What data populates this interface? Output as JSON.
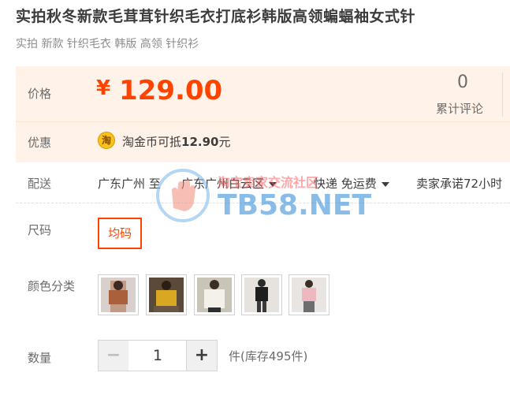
{
  "product": {
    "title": "实拍秋冬新款毛茸茸针织毛衣打底衫韩版高领蝙蝠袖女式针",
    "subtitle": "实拍 新款 针织毛衣 韩版 高领 针织衫"
  },
  "price": {
    "label": "价格",
    "currency": "¥",
    "value": "129.00",
    "review_count": "0",
    "review_label": "累计评论"
  },
  "promo": {
    "label": "优惠",
    "coin_icon_text": "淘",
    "text_prefix": "淘金币可抵",
    "amount": "12.90",
    "text_suffix": "元"
  },
  "delivery": {
    "label": "配送",
    "from": "广东广州 至",
    "to": "广东广州白云区",
    "method": "快递 免运费",
    "promise": "卖家承诺72小时"
  },
  "size": {
    "label": "尺码",
    "options": [
      "均码"
    ]
  },
  "color": {
    "label": "颜色分类",
    "thumbnails": [
      "brown-sweater-thumb",
      "yellow-sweater-thumb",
      "white-sweater-thumb",
      "black-outfit-thumb",
      "pink-sweater-thumb"
    ]
  },
  "quantity": {
    "label": "数量",
    "minus": "−",
    "value": "1",
    "plus": "+",
    "stock_text": "件(库存495件)"
  },
  "watermark": {
    "top_text": "淘宝卖家交流社区",
    "big_text": "TB58.NET"
  },
  "colors": {
    "accent": "#ff4400",
    "panel_bg": "#fff2e8",
    "coin": "#f7c31a"
  }
}
